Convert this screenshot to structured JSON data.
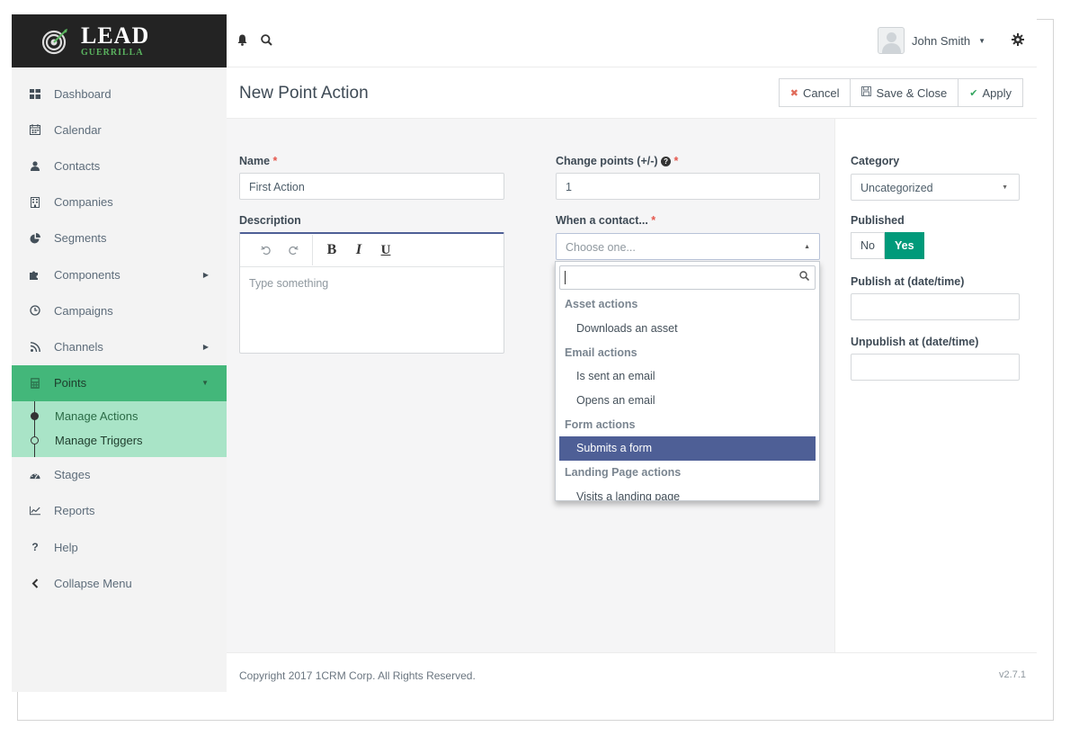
{
  "brand": {
    "name": "LEAD",
    "tagline": "GUERRILLA"
  },
  "sidebar": {
    "items": [
      {
        "label": "Dashboard",
        "icon": "dashboard-icon"
      },
      {
        "label": "Calendar",
        "icon": "calendar-icon"
      },
      {
        "label": "Contacts",
        "icon": "user-icon"
      },
      {
        "label": "Companies",
        "icon": "building-icon"
      },
      {
        "label": "Segments",
        "icon": "pie-chart-icon"
      },
      {
        "label": "Components",
        "icon": "puzzle-icon",
        "has_submenu": true
      },
      {
        "label": "Campaigns",
        "icon": "clock-icon"
      },
      {
        "label": "Channels",
        "icon": "rss-icon",
        "has_submenu": true
      },
      {
        "label": "Points",
        "icon": "calculator-icon",
        "active": true,
        "expanded": true
      },
      {
        "label": "Stages",
        "icon": "tachometer-icon"
      },
      {
        "label": "Reports",
        "icon": "line-chart-icon"
      },
      {
        "label": "Help",
        "icon": "question-icon"
      },
      {
        "label": "Collapse Menu",
        "icon": "chevron-left-icon"
      }
    ],
    "points_submenu": [
      {
        "label": "Manage Actions",
        "current": true
      },
      {
        "label": "Manage Triggers",
        "current": false
      }
    ]
  },
  "topbar": {
    "user_name": "John Smith"
  },
  "header": {
    "title": "New Point Action",
    "cancel_label": "Cancel",
    "save_close_label": "Save & Close",
    "apply_label": "Apply"
  },
  "form": {
    "name_label": "Name",
    "name_value": "First Action",
    "description_label": "Description",
    "description_placeholder": "Type something",
    "change_points_label": "Change points (+/-)",
    "change_points_value": "1",
    "when_contact_label": "When a contact...",
    "when_contact_placeholder": "Choose one...",
    "required_mark": "*"
  },
  "dropdown": {
    "groups": [
      {
        "label": "Asset actions",
        "options": [
          {
            "label": "Downloads an asset"
          }
        ]
      },
      {
        "label": "Email actions",
        "options": [
          {
            "label": "Is sent an email"
          },
          {
            "label": "Opens an email"
          }
        ]
      },
      {
        "label": "Form actions",
        "options": [
          {
            "label": "Submits a form",
            "highlighted": true
          }
        ]
      },
      {
        "label": "Landing Page actions",
        "options": [
          {
            "label": "Visits a landing page"
          }
        ]
      }
    ]
  },
  "sidepanel": {
    "category_label": "Category",
    "category_value": "Uncategorized",
    "published_label": "Published",
    "no_label": "No",
    "yes_label": "Yes",
    "published_value": "Yes",
    "publish_at_label": "Publish at (date/time)",
    "publish_at_value": "",
    "unpublish_at_label": "Unpublish at (date/time)",
    "unpublish_at_value": ""
  },
  "footer": {
    "copyright": "Copyright 2017 1CRM Corp. All Rights Reserved.",
    "version": "v2.7.1"
  },
  "colors": {
    "accent_green": "#43b77a",
    "submenu_green": "#a9e4c7",
    "highlight_blue": "#4e5f96",
    "toggle_on": "#009a7a",
    "required_red": "#e5574d"
  }
}
